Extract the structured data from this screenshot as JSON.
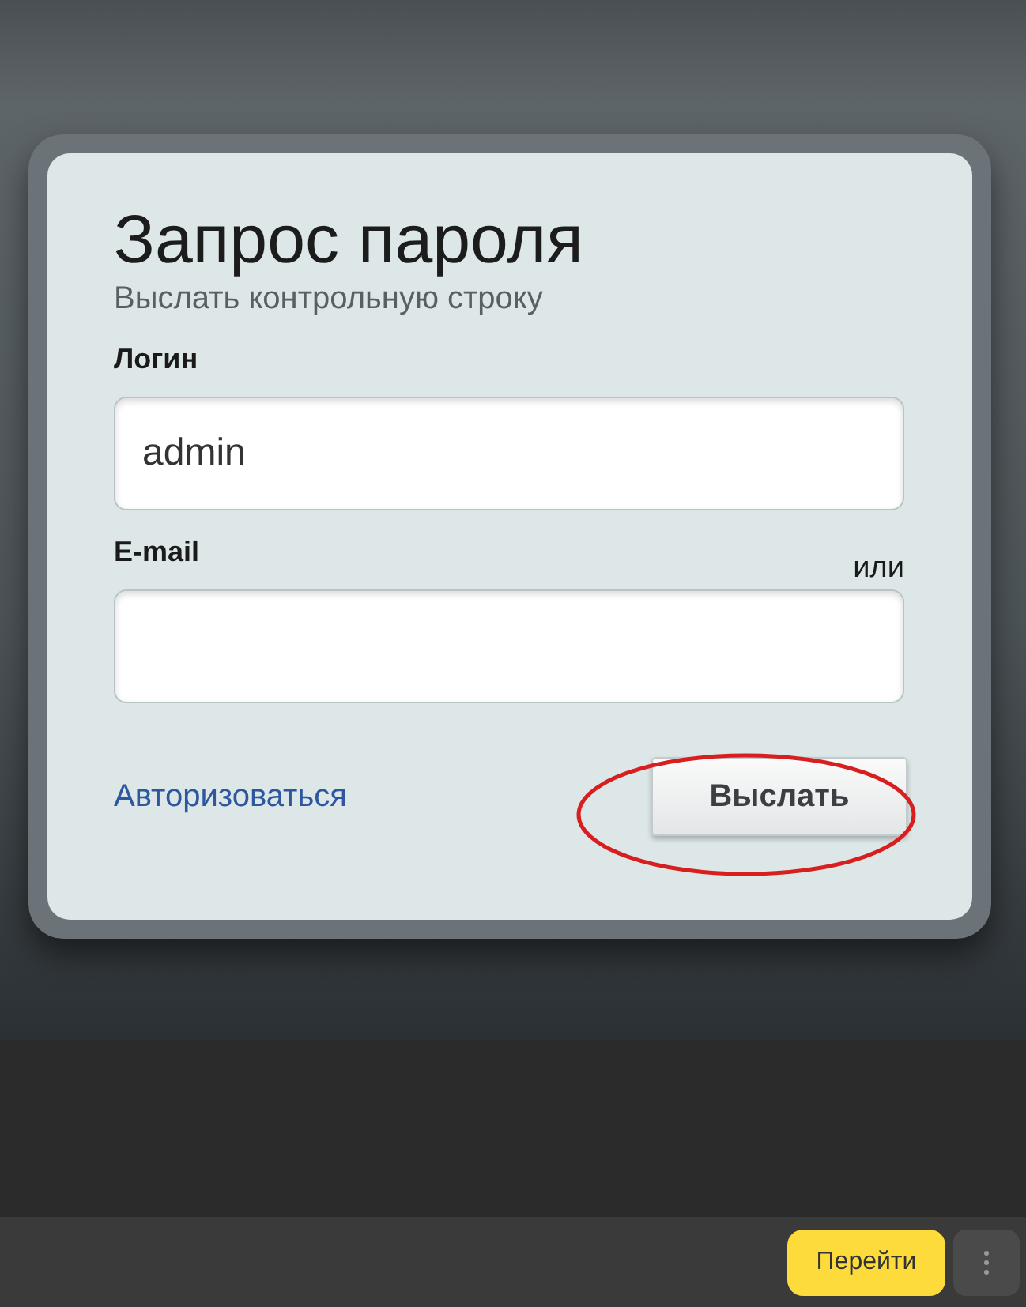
{
  "form": {
    "title": "Запрос пароля",
    "subtitle": "Выслать контрольную строку",
    "fields": [
      {
        "label": "Логин",
        "value": "admin"
      },
      {
        "label": "E-mail",
        "aside": "или"
      }
    ],
    "link": "Авторизоваться",
    "submit": "Выслать",
    "submit_circled": true
  },
  "bottom_bar": {
    "go_button": "Перейти"
  }
}
